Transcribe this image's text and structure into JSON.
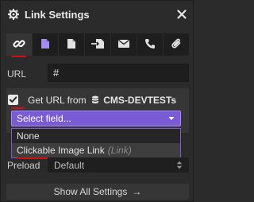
{
  "header": {
    "title": "Link Settings",
    "gear_icon": "gear-icon",
    "close_icon": "close-icon"
  },
  "link_types": [
    {
      "name": "link-type-url",
      "icon": "chain-link-icon",
      "active": true
    },
    {
      "name": "link-type-page",
      "icon": "page-icon",
      "active": false
    },
    {
      "name": "link-type-document",
      "icon": "document-icon",
      "active": false
    },
    {
      "name": "link-type-section",
      "icon": "section-arrow-icon",
      "active": false
    },
    {
      "name": "link-type-email",
      "icon": "envelope-icon",
      "active": false
    },
    {
      "name": "link-type-phone",
      "icon": "phone-icon",
      "active": false
    },
    {
      "name": "link-type-file",
      "icon": "paperclip-icon",
      "active": false
    }
  ],
  "url": {
    "label": "URL",
    "value": "#"
  },
  "cms": {
    "checked": true,
    "label_prefix": "Get URL from",
    "collection": "CMS-DEVTESTs",
    "select_placeholder": "Select field...",
    "options": [
      {
        "label": "None",
        "hint": ""
      },
      {
        "label": "Clickable Image Link",
        "hint": "(Link)"
      }
    ]
  },
  "preload": {
    "label": "Preload",
    "value": "Default"
  },
  "footer": {
    "show_all_label": "Show All Settings",
    "arrow": "→"
  },
  "colors": {
    "accent": "#7a5bd6",
    "annotation_red": "#d10f0f",
    "panel_bg": "#2b2b2b"
  }
}
